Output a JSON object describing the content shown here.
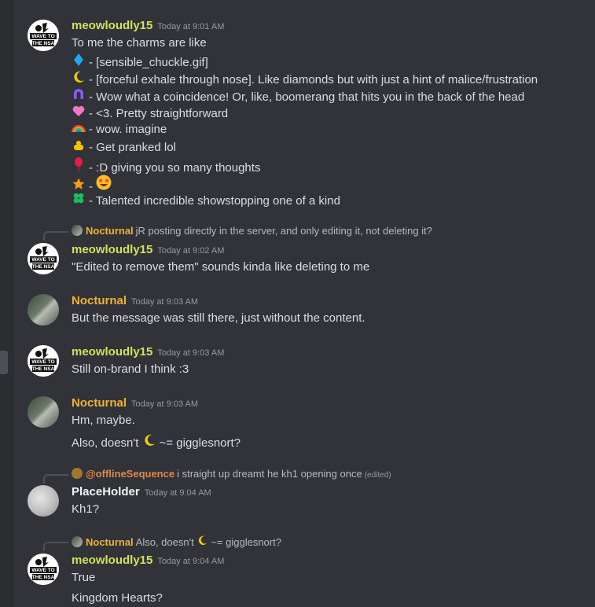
{
  "messages": [
    {
      "author": "meowloudly15",
      "time": "Today at 9:01 AM",
      "lines": [
        "To me the charms are like",
        "- [sensible_chuckle.gif]",
        "- [forceful exhale through nose]. Like diamonds but with just a hint of malice/frustration",
        "- Wow what a coincidence! Or, like, boomerang that hits you in the back of the head",
        "- <3. Pretty straightforward",
        "- wow. imagine",
        "- Get pranked lol",
        "- :D giving you so many thoughts",
        "-",
        "- Talented incredible showstopping one of a kind"
      ],
      "icons": [
        "diamond-icon",
        "moon-icon",
        "magnet-icon",
        "heart-icon",
        "rainbow-icon",
        "pot-of-gold-icon",
        "balloon-icon",
        "star-icon",
        "clover-icon"
      ]
    },
    {
      "reply": {
        "author": "Nocturnal",
        "text": "jR posting directly in the server, and only editing it, not deleting it?"
      },
      "author": "meowloudly15",
      "time": "Today at 9:02 AM",
      "lines": [
        "\"Edited to remove them\" sounds kinda like deleting to me"
      ]
    },
    {
      "author": "Nocturnal",
      "time": "Today at 9:03 AM",
      "lines": [
        "But the message was still there, just without the content."
      ]
    },
    {
      "author": "meowloudly15",
      "time": "Today at 9:03 AM",
      "lines": [
        "Still on-brand I think :3"
      ]
    },
    {
      "author": "Nocturnal",
      "time": "Today at 9:03 AM",
      "lines": [
        "Hm, maybe.",
        "Also, doesn't",
        "~= gigglesnort?"
      ]
    },
    {
      "reply": {
        "author": "@offlineSequence",
        "text": "i straight up dreamt he kh1 opening once",
        "edited": "(edited)"
      },
      "author": "PlaceHolder",
      "time": "Today at 9:04 AM",
      "lines": [
        "Kh1?"
      ]
    },
    {
      "reply": {
        "author": "Nocturnal",
        "text": "Also, doesn't",
        "text2": "~= gigglesnort?"
      },
      "author": "meowloudly15",
      "time": "Today at 9:04 AM",
      "lines": [
        "True",
        "Kingdom Hearts?"
      ]
    }
  ],
  "avatar_text": {
    "line1": "WAVE TO",
    "line2": "THE NSA"
  },
  "colors": {
    "background": "#313338",
    "meowloudly15": "#d4e157",
    "Nocturnal": "#f0b232",
    "PlaceHolder": "#f2f3f5",
    "offlineSequence": "#e0884a"
  }
}
